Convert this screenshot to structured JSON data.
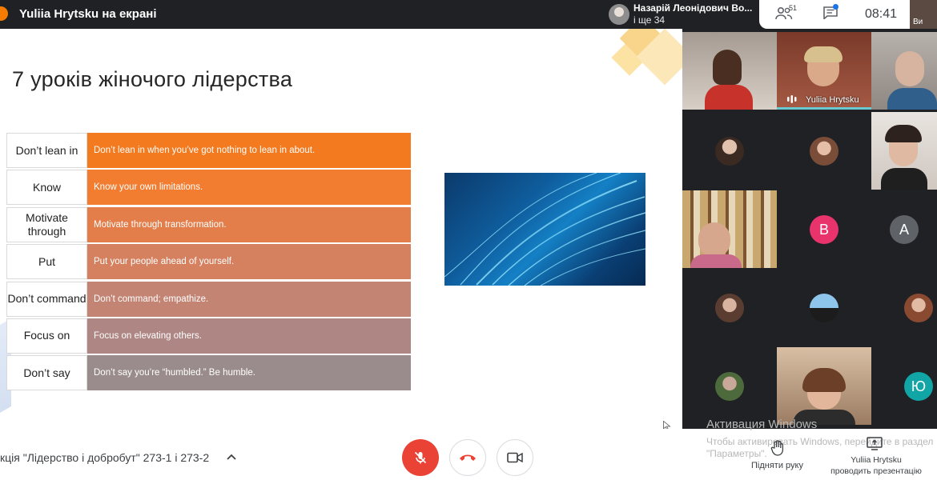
{
  "topbar": {
    "presenting_title": "Yuliia Hrytsku на екрані",
    "notification_name": "Назарій Леонідович Во...",
    "notification_more": "і ще 34",
    "people_count": "51",
    "time": "08:41",
    "self_label": "Ви"
  },
  "slide": {
    "title": "7 уроків жіночого лідерства",
    "lessons": [
      {
        "key": "Don’t lean in",
        "text": "Don’t lean in when you’ve got nothing to lean in about.",
        "color": "#f47a1f"
      },
      {
        "key": "Know",
        "text": "Know your own limitations.",
        "color": "#f27c30"
      },
      {
        "key": "Motivate through",
        "text": "Motivate through transformation.",
        "color": "#e37e4a"
      },
      {
        "key": "Put",
        "text": "Put your people ahead of yourself.",
        "color": "#d5805f"
      },
      {
        "key": "Don’t command",
        "text": "Don’t command; empathize.",
        "color": "#c38474"
      },
      {
        "key": "Focus on",
        "text": "Focus on elevating others.",
        "color": "#ae8684"
      },
      {
        "key": "Don’t say",
        "text": "Don’t say you’re “humbled.” Be humble.",
        "color": "#9a8c8c"
      }
    ]
  },
  "participants": {
    "active_speaker_name": "Yuliia Hrytsku",
    "letter_avatars": [
      {
        "letter": "В",
        "color": "#e8336d"
      },
      {
        "letter": "А",
        "color": "#5f6368"
      },
      {
        "letter": "Ю",
        "color": "#12a5a6"
      }
    ]
  },
  "bottombar": {
    "meeting_name": "кція \"Лідерство і добробут\" 273-1 і 273-2",
    "raise_hand_label": "Підняти руку",
    "presenter_name": "Yuliia Hrytsku",
    "presenter_status": "проводить презентацію",
    "watermark_title": "Активация Windows",
    "watermark_line1": "Чтобы активировать Windows, перейдите в раздел",
    "watermark_line2": "\"Параметры\"."
  },
  "colors": {
    "end_call": "#ea4335",
    "accent": "#1a73e8"
  }
}
